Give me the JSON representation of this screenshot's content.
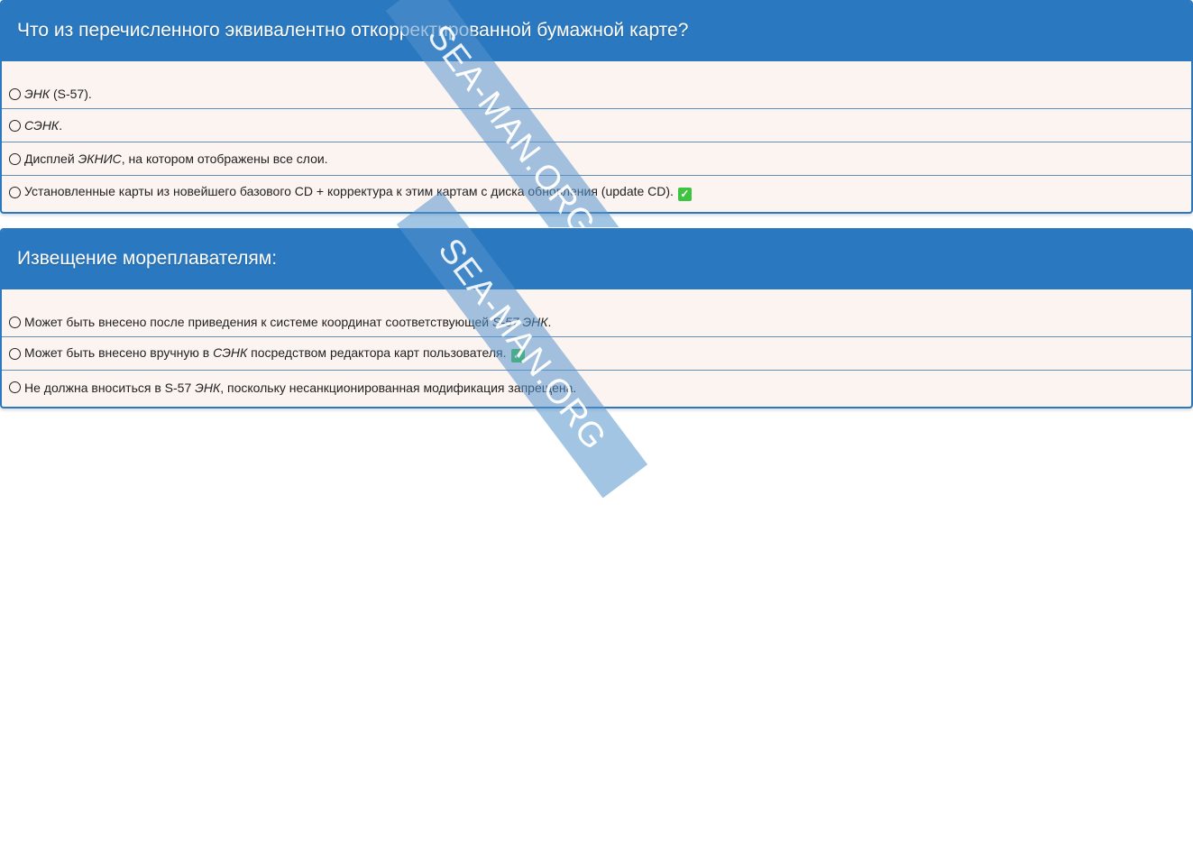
{
  "questions": [
    {
      "title": "Что из перечисленного эквивалентно откорректированной бумажной карте?",
      "answers": [
        {
          "pre": "",
          "em": "ЭНК",
          "post": " (S-57).",
          "correct": false
        },
        {
          "pre": "",
          "em": "СЭНК",
          "post": ".",
          "correct": false
        },
        {
          "pre": "Дисплей ",
          "em": "ЭКНИС",
          "post": ", на котором отображены все слои.",
          "correct": false
        },
        {
          "pre": "Установленные карты из новейшего базового CD + корректура к этим картам с диска обновления (update CD).",
          "em": "",
          "post": "",
          "correct": true
        }
      ]
    },
    {
      "title": "Извещение мореплавателям:",
      "answers": [
        {
          "pre": "Может быть внесено после приведения к системе координат соответствующей ",
          "em": "S-57 ЭНК",
          "post": ".",
          "correct": false
        },
        {
          "pre": "Может быть внесено вручную в ",
          "em": "СЭНК",
          "post": " посредством редактора карт пользователя.",
          "correct": true
        },
        {
          "pre": "Не должна вноситься в S-57 ",
          "em": "ЭНК",
          "post": ", поскольку несанкционированная модификация запрещена.",
          "correct": false
        }
      ]
    }
  ],
  "watermark": "SEA-MAN.ORG",
  "colors": {
    "header": "#2a78bf",
    "body": "#fcf4f1",
    "check": "#3ec441"
  },
  "icons": {
    "radio": "radio-circle-icon",
    "correct": "check-mark-icon"
  }
}
